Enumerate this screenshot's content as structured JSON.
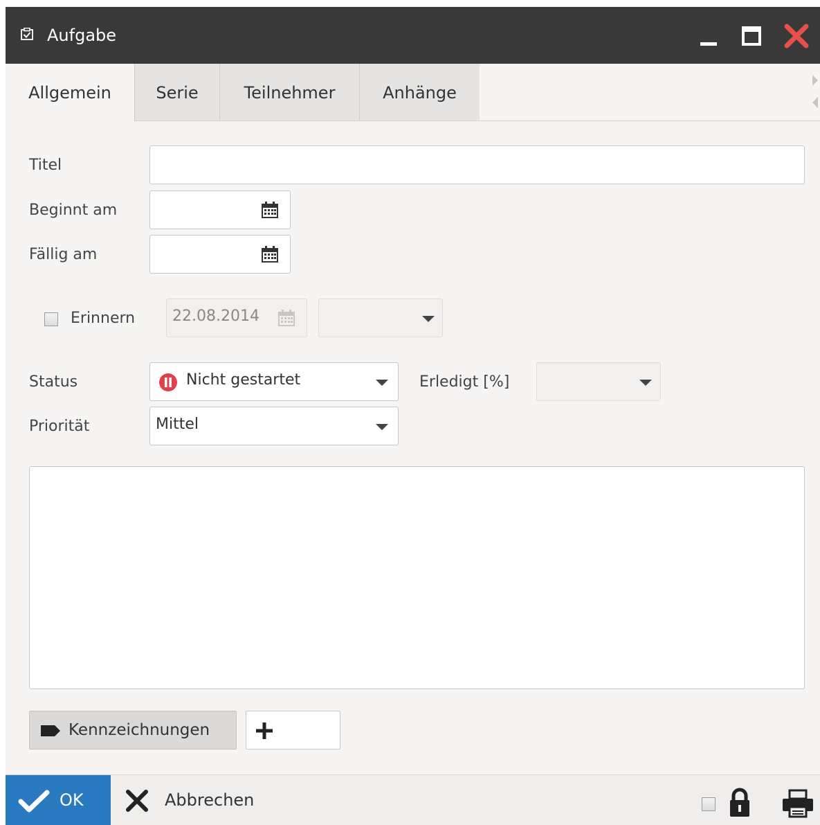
{
  "window": {
    "title": "Aufgabe"
  },
  "tabs": [
    {
      "label": "Allgemein"
    },
    {
      "label": "Serie"
    },
    {
      "label": "Teilnehmer"
    },
    {
      "label": "Anhänge"
    }
  ],
  "form": {
    "title_label": "Titel",
    "title_value": "",
    "start_label": "Beginnt am",
    "start_value": "",
    "due_label": "Fällig am",
    "due_value": "",
    "remind_label": "Erinnern",
    "remind_checked": false,
    "remind_date": "22.08.2014",
    "remind_time": "",
    "status_label": "Status",
    "status_value": "Nicht gestartet",
    "done_label": "Erledigt [%]",
    "done_value": "",
    "priority_label": "Priorität",
    "priority_value": "Mittel",
    "notes_value": ""
  },
  "tags": {
    "button_label": "Kennzeichnungen"
  },
  "footer": {
    "ok_label": "OK",
    "cancel_label": "Abbrechen",
    "private_checked": false
  },
  "colors": {
    "titlebar": "#393939",
    "close": "#e8504d",
    "ok": "#2a7ac1",
    "status_icon": "#e0414f"
  }
}
